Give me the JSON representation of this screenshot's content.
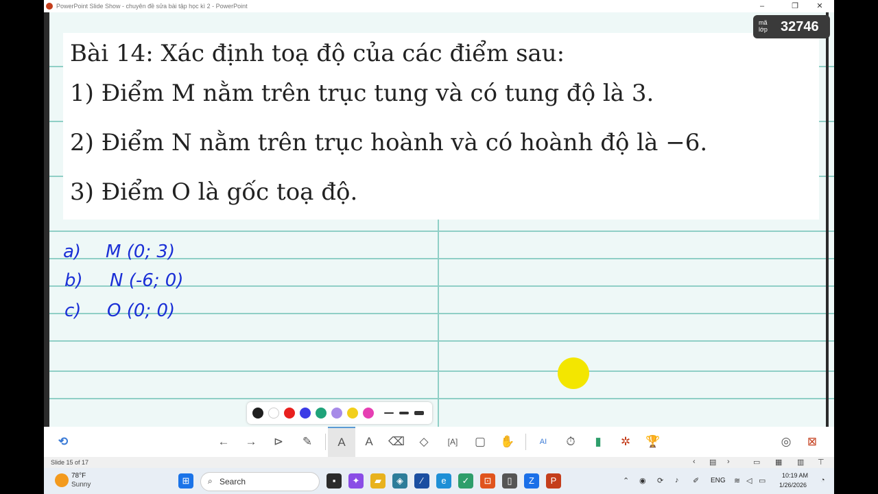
{
  "window": {
    "title": "PowerPoint Slide Show  -  chuyên đề sửa bài tập học kì 2 - PowerPoint"
  },
  "badge": {
    "label": "mã lớp",
    "code": "32746"
  },
  "problem": {
    "heading": "Bài 14: Xác định toạ độ của các điểm sau:",
    "items": [
      "1) Điểm M nằm trên trục tung và có tung độ là 3.",
      "2) Điểm N nằm trên trục hoành và có hoành độ là −6.",
      "3) Điểm O là gốc toạ độ."
    ]
  },
  "answers": [
    {
      "label": "a)",
      "value": "M (0; 3)"
    },
    {
      "label": "b)",
      "value": "N (-6; 0)"
    },
    {
      "label": "c)",
      "value": "O (0; 0)"
    }
  ],
  "palette": {
    "colors": [
      "#1f1f1f",
      "#ffffff",
      "#e8201e",
      "#3b3be6",
      "#1fa37a",
      "#a78be8",
      "#f2cf1b",
      "#e63fb3"
    ]
  },
  "status": {
    "slide": "Slide 15 of 17"
  },
  "weather": {
    "temp": "78°F",
    "desc": "Sunny"
  },
  "taskbar": {
    "search_placeholder": "Search",
    "lang": "ENG",
    "time": "10:19 AM",
    "date": "1/26/2026"
  }
}
